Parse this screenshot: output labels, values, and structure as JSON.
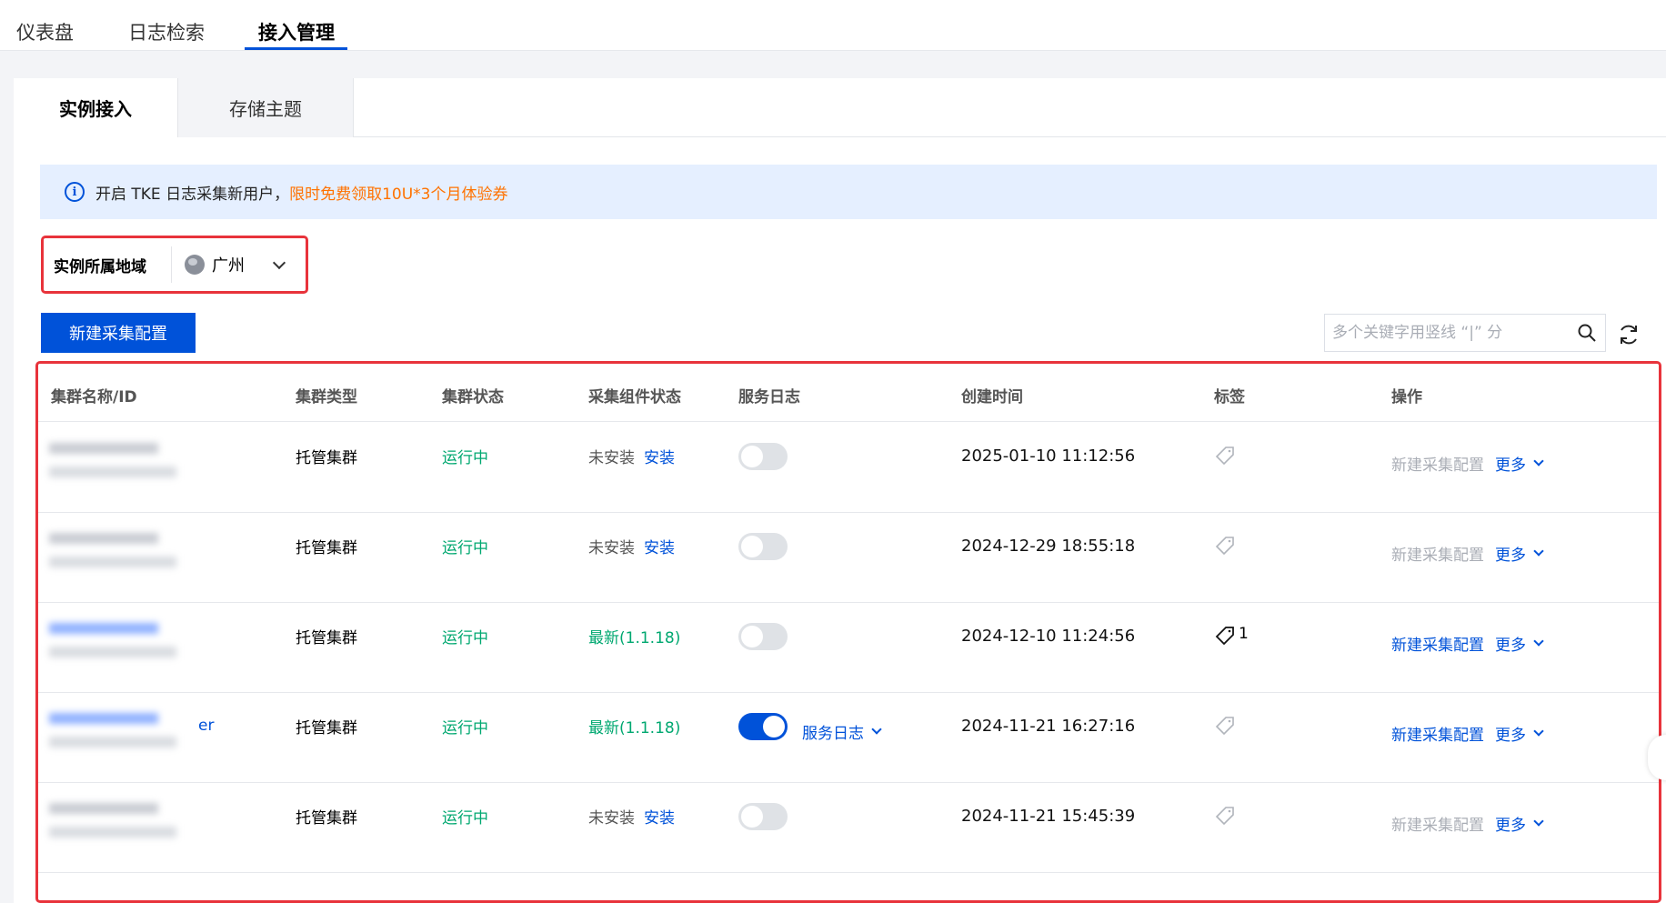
{
  "topnav": {
    "tabs": [
      {
        "label": "仪表盘"
      },
      {
        "label": "日志检索"
      },
      {
        "label": "接入管理"
      }
    ]
  },
  "subtabs": {
    "active": "实例接入",
    "inactive": "存储主题"
  },
  "notice": {
    "text": "开启 TKE 日志采集新用户，",
    "highlight": "限时免费领取10U*3个月体验券"
  },
  "region": {
    "label": "实例所属地域",
    "value": "广州"
  },
  "toolbar": {
    "new_button": "新建采集配置",
    "search_placeholder": "多个关键字用竖线 “|” 分"
  },
  "table": {
    "headers": [
      "集群名称/ID",
      "集群类型",
      "集群状态",
      "采集组件状态",
      "服务日志",
      "创建时间",
      "标签",
      "操作"
    ],
    "rows": [
      {
        "type": "托管集群",
        "status": "运行中",
        "component": "未安装",
        "install": "安装",
        "service_log": false,
        "created": "2025-01-10 11:12:56",
        "tag_count": "",
        "create_config": "新建采集配置",
        "more": "更多"
      },
      {
        "type": "托管集群",
        "status": "运行中",
        "component": "未安装",
        "install": "安装",
        "service_log": false,
        "created": "2024-12-29 18:55:18",
        "tag_count": "",
        "create_config": "新建采集配置",
        "more": "更多"
      },
      {
        "type": "托管集群",
        "status": "运行中",
        "component": "最新(1.1.18)",
        "install": "",
        "service_log": false,
        "created": "2024-12-10 11:24:56",
        "tag_count": "1",
        "create_config": "新建采集配置",
        "more": "更多"
      },
      {
        "name_suffix": "er",
        "type": "托管集群",
        "status": "运行中",
        "component": "最新(1.1.18)",
        "install": "",
        "service_log": true,
        "service_log_label": "服务日志",
        "created": "2024-11-21 16:27:16",
        "tag_count": "",
        "create_config": "新建采集配置",
        "more": "更多"
      },
      {
        "type": "托管集群",
        "status": "运行中",
        "component": "未安装",
        "install": "安装",
        "service_log": false,
        "created": "2024-11-21 15:45:39",
        "tag_count": "",
        "create_config": "新建采集配置",
        "more": "更多"
      }
    ]
  },
  "colors": {
    "primary": "#0052d9",
    "success": "#00a870",
    "warning": "#ff7200",
    "highlight_border": "#e8333b"
  }
}
